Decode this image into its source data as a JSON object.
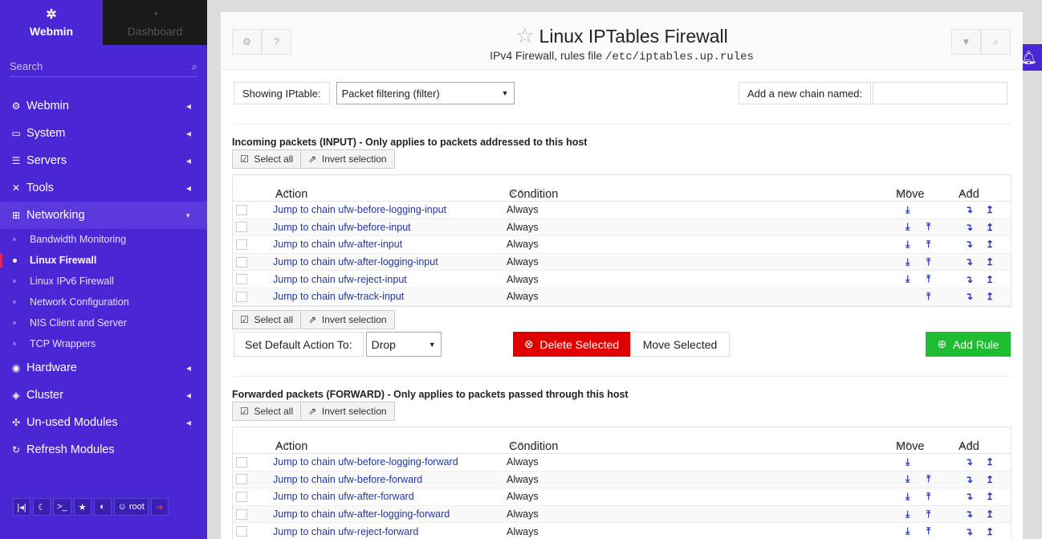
{
  "sidebar": {
    "webmin_label": "Webmin",
    "dashboard_label": "Dashboard",
    "search_placeholder": "Search",
    "menu": [
      {
        "label": "Webmin",
        "icon": "gear-icon"
      },
      {
        "label": "System",
        "icon": "monitor-icon"
      },
      {
        "label": "Servers",
        "icon": "server-icon"
      },
      {
        "label": "Tools",
        "icon": "tools-icon"
      },
      {
        "label": "Networking",
        "icon": "network-icon"
      }
    ],
    "submenu": [
      "Bandwidth Monitoring",
      "Linux Firewall",
      "Linux IPv6 Firewall",
      "Network Configuration",
      "NIS Client and Server",
      "TCP Wrappers"
    ],
    "menu2": [
      {
        "label": "Hardware",
        "icon": "hardware-icon"
      },
      {
        "label": "Cluster",
        "icon": "cluster-icon"
      },
      {
        "label": "Un-used Modules",
        "icon": "puzzle-icon"
      },
      {
        "label": "Refresh Modules",
        "icon": "refresh-icon"
      }
    ],
    "user": "root"
  },
  "header": {
    "title": "Linux IPTables Firewall",
    "subtitle_prefix": "IPv4 Firewall, rules file ",
    "subtitle_file": "/etc/iptables.up.rules"
  },
  "controls": {
    "showing_label": "Showing IPtable:",
    "table_value": "Packet filtering (filter)",
    "new_chain_label": "Add a new chain named:"
  },
  "input_section": {
    "title": "Incoming packets (INPUT) - Only applies to packets addressed to this host",
    "select_all": "Select all",
    "invert": "Invert selection",
    "columns": [
      "Action",
      "Condition",
      "Move",
      "Add"
    ],
    "rows": [
      {
        "action": "Jump to chain ufw-before-logging-input",
        "cond": "Always",
        "down": true,
        "up": false
      },
      {
        "action": "Jump to chain ufw-before-input",
        "cond": "Always",
        "down": true,
        "up": true
      },
      {
        "action": "Jump to chain ufw-after-input",
        "cond": "Always",
        "down": true,
        "up": true
      },
      {
        "action": "Jump to chain ufw-after-logging-input",
        "cond": "Always",
        "down": true,
        "up": true
      },
      {
        "action": "Jump to chain ufw-reject-input",
        "cond": "Always",
        "down": true,
        "up": true
      },
      {
        "action": "Jump to chain ufw-track-input",
        "cond": "Always",
        "down": false,
        "up": true
      }
    ],
    "default_label": "Set Default Action To:",
    "default_value": "Drop",
    "delete_btn": "Delete Selected",
    "move_btn": "Move Selected",
    "add_btn": "Add Rule"
  },
  "forward_section": {
    "title": "Forwarded packets (FORWARD) - Only applies to packets passed through this host",
    "select_all": "Select all",
    "invert": "Invert selection",
    "columns": [
      "Action",
      "Condition",
      "Move",
      "Add"
    ],
    "rows": [
      {
        "action": "Jump to chain ufw-before-logging-forward",
        "cond": "Always",
        "down": true,
        "up": false
      },
      {
        "action": "Jump to chain ufw-before-forward",
        "cond": "Always",
        "down": true,
        "up": true
      },
      {
        "action": "Jump to chain ufw-after-forward",
        "cond": "Always",
        "down": true,
        "up": true
      },
      {
        "action": "Jump to chain ufw-after-logging-forward",
        "cond": "Always",
        "down": true,
        "up": true
      },
      {
        "action": "Jump to chain ufw-reject-forward",
        "cond": "Always",
        "down": true,
        "up": true
      }
    ]
  }
}
